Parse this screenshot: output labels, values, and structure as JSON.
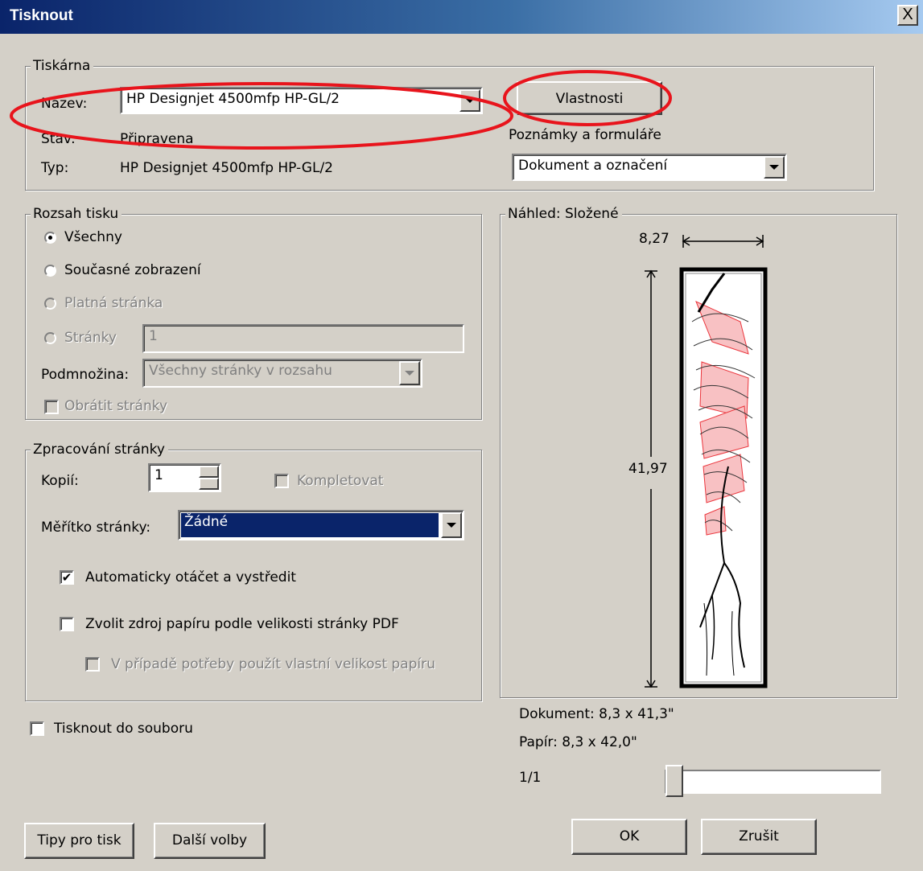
{
  "window": {
    "title": "Tisknout",
    "close_label": "X"
  },
  "printer": {
    "group_label": "Tiskárna",
    "name_label": "Název:",
    "name_value": "HP Designjet 4500mfp HP-GL/2",
    "status_label": "Stav:",
    "status_value": "Připravena",
    "type_label": "Typ:",
    "type_value": "HP Designjet 4500mfp HP-GL/2",
    "properties_button": "Vlastnosti",
    "comments_label": "Poznámky a formuláře",
    "comments_value": "Dokument a označení"
  },
  "print_range": {
    "group_label": "Rozsah tisku",
    "all_label": "Všechny",
    "current_view_label": "Současné zobrazení",
    "current_page_label": "Platná stránka",
    "pages_label": "Stránky",
    "pages_value": "1",
    "subset_label": "Podmnožina:",
    "subset_value": "Všechny stránky v rozsahu",
    "reverse_label": "Obrátit stránky"
  },
  "page_handling": {
    "group_label": "Zpracování stránky",
    "copies_label": "Kopií:",
    "copies_value": "1",
    "collate_label": "Kompletovat",
    "scaling_label": "Měřítko stránky:",
    "scaling_value": "Žádné",
    "auto_rotate_label": "Automaticky otáčet a vystředit",
    "auto_rotate_checked": true,
    "paper_source_label": "Zvolit zdroj papíru podle velikosti stránky PDF",
    "custom_paper_label": "V případě potřeby použít vlastní velikost papíru"
  },
  "print_to_file_label": "Tisknout do souboru",
  "preview": {
    "group_label": "Náhled: Složené",
    "width_value": "8,27",
    "height_value": "41,97",
    "document_size": "Dokument: 8,3 x 41,3\"",
    "paper_size": "Papír: 8,3 x 42,0\"",
    "page_indicator": "1/1",
    "slider_position": 0
  },
  "buttons": {
    "tips": "Tipy pro tisk",
    "advanced": "Další volby",
    "ok": "OK",
    "cancel": "Zrušit"
  },
  "colors": {
    "annotation": "#e8141c",
    "highlight": "#0a246a"
  }
}
